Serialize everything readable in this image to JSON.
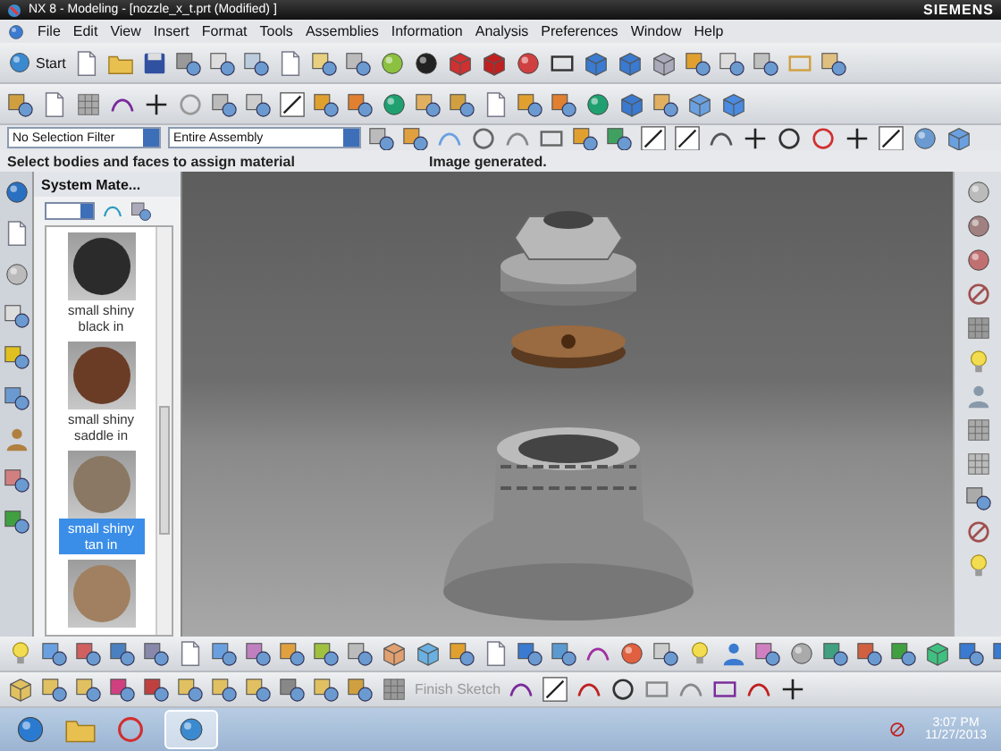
{
  "window": {
    "title": "NX 8 - Modeling - [nozzle_x_t.prt (Modified) ]",
    "brand": "SIEMENS"
  },
  "menu": [
    {
      "label": "File"
    },
    {
      "label": "Edit"
    },
    {
      "label": "View"
    },
    {
      "label": "Insert"
    },
    {
      "label": "Format"
    },
    {
      "label": "Tools"
    },
    {
      "label": "Assemblies"
    },
    {
      "label": "Information"
    },
    {
      "label": "Analysis"
    },
    {
      "label": "Preferences"
    },
    {
      "label": "Window"
    },
    {
      "label": "Help"
    }
  ],
  "toolbar": {
    "start_label": "Start"
  },
  "selection_bar": {
    "filter": "No Selection Filter",
    "scope": "Entire Assembly"
  },
  "status_bar": {
    "prompt": "Select bodies and faces to assign material",
    "message": "Image generated."
  },
  "materials_panel": {
    "title": "System Mate...",
    "materials": [
      {
        "name": "small shiny black in",
        "color": "#2b2b2b",
        "selected": false
      },
      {
        "name": "small shiny saddle in",
        "color": "#6a3c26",
        "selected": false
      },
      {
        "name": "small shiny tan in",
        "color": "#8a7864",
        "selected": true
      }
    ]
  },
  "sketch_toolbar": {
    "finish_label": "Finish Sketch"
  },
  "taskbar": {
    "time": "3:07 PM",
    "date": "11/27/2013"
  }
}
